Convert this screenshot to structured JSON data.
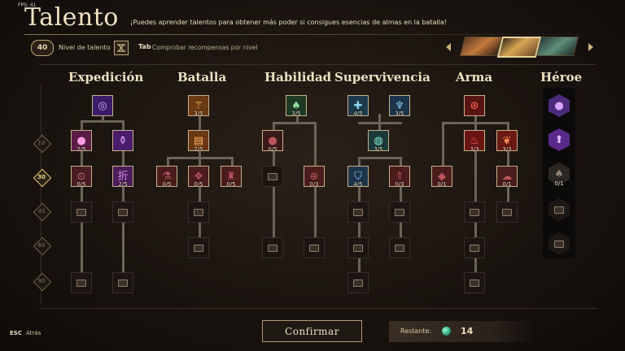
{
  "fps": "FPS: 41",
  "header": {
    "title": "Talento",
    "subtitle": "¡Puedes aprender talentos para obtener más poder si consigues esencias de almas en la batalla!",
    "level": "40",
    "level_label": "Nivel de talento",
    "tab_key": "Tab",
    "tab_label": "Comprobar recompensas por nivel"
  },
  "columns": [
    "Expedición",
    "Batalla",
    "Habilidad",
    "Supervivencia",
    "Arma",
    "Héroe"
  ],
  "levels": [
    "10",
    "30",
    "45",
    "60",
    "90"
  ],
  "active_level": "30",
  "counts": {
    "exp_r2a": "2/5",
    "exp_r3a": "0/5",
    "exp_r3b": "2/5",
    "bat_r1": "3/5",
    "bat_r2": "2/5",
    "bat_r3a": "0/5",
    "bat_r3b": "0/5",
    "bat_r3c": "0/5",
    "hab_r1": "3/5",
    "hab_r2": "0/5",
    "hab_r3": "0/3",
    "sup_r1a": "4/5",
    "sup_r1b": "3/5",
    "sup_r2": "3/5",
    "sup_r3a": "4/5",
    "sup_r3b": "0/3",
    "arm_r2a": "3/3",
    "arm_r2b": "3/3",
    "arm_r3a": "0/1",
    "arm_r3b": "0/1",
    "hero_r3": "0/1"
  },
  "icons": {
    "expedicion_top": "swirl-icon",
    "batalla_top": "totem-icon",
    "habilidad_top": "leaf-icon",
    "supervivencia_a": "cross-icon",
    "supervivencia_b": "mask-icon",
    "arma_top": "target-icon",
    "locked": "lock-icon"
  },
  "colors": {
    "accent": "#c6b08a",
    "gem": "#2aa47e",
    "active_level": "#f0d68a"
  },
  "footer": {
    "confirm": "Confirmar",
    "remaining_label": "Restante:",
    "remaining_value": "14",
    "esc_key": "ESC",
    "esc_label": "Atrás"
  }
}
